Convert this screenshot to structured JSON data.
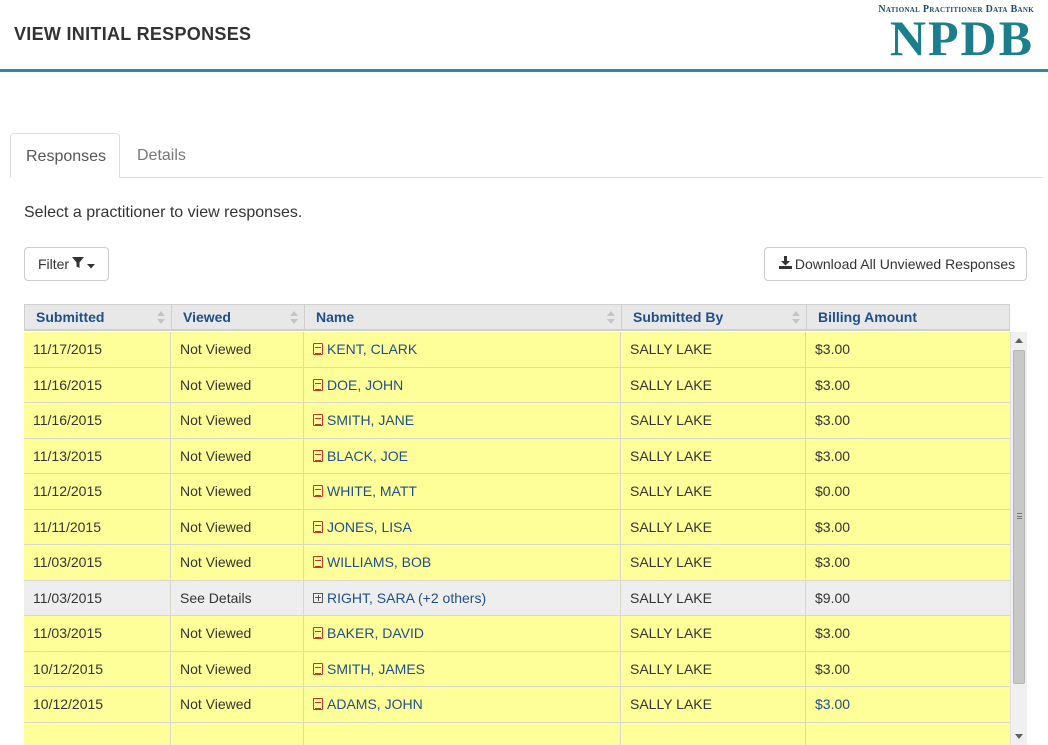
{
  "header": {
    "title": "VIEW INITIAL RESPONSES",
    "logo_sub": "National Practitioner Data Bank",
    "logo_main": "NPDB"
  },
  "tabs": [
    {
      "label": "Responses",
      "active": true
    },
    {
      "label": "Details",
      "active": false
    }
  ],
  "instructions": "Select a practitioner to view responses.",
  "toolbar": {
    "filter_label": "Filter",
    "download_label": "Download All Unviewed Responses"
  },
  "table": {
    "columns": [
      "Submitted",
      "Viewed",
      "Name",
      "Submitted By",
      "Billing Amount"
    ],
    "rows": [
      {
        "submitted": "11/17/2015",
        "viewed": "Not Viewed",
        "name": "KENT, CLARK",
        "submitted_by": "SALLY LAKE",
        "billing": "$3.00",
        "icon": "pdf-icon",
        "highlight": "yellow"
      },
      {
        "submitted": "11/16/2015",
        "viewed": "Not Viewed",
        "name": "DOE, JOHN",
        "submitted_by": "SALLY LAKE",
        "billing": "$3.00",
        "icon": "pdf-icon",
        "highlight": "yellow"
      },
      {
        "submitted": "11/16/2015",
        "viewed": "Not Viewed",
        "name": "SMITH, JANE",
        "submitted_by": "SALLY LAKE",
        "billing": "$3.00",
        "icon": "pdf-icon",
        "highlight": "yellow"
      },
      {
        "submitted": "11/13/2015",
        "viewed": "Not Viewed",
        "name": "BLACK, JOE",
        "submitted_by": "SALLY LAKE",
        "billing": "$3.00",
        "icon": "pdf-icon",
        "highlight": "yellow"
      },
      {
        "submitted": "11/12/2015",
        "viewed": "Not Viewed",
        "name": "WHITE, MATT",
        "submitted_by": "SALLY LAKE",
        "billing": "$0.00",
        "icon": "pdf-icon",
        "highlight": "yellow"
      },
      {
        "submitted": "11/11/2015",
        "viewed": "Not Viewed",
        "name": "JONES, LISA",
        "submitted_by": "SALLY LAKE",
        "billing": "$3.00",
        "icon": "pdf-icon",
        "highlight": "yellow"
      },
      {
        "submitted": "11/03/2015",
        "viewed": "Not Viewed",
        "name": "WILLIAMS, BOB",
        "submitted_by": "SALLY LAKE",
        "billing": "$3.00",
        "icon": "pdf-icon",
        "highlight": "yellow"
      },
      {
        "submitted": "11/03/2015",
        "viewed": "See Details",
        "name": "RIGHT, SARA (+2 others)",
        "submitted_by": "SALLY LAKE",
        "billing": "$9.00",
        "icon": "plus-square-icon",
        "highlight": "grey"
      },
      {
        "submitted": "11/03/2015",
        "viewed": "Not Viewed",
        "name": "BAKER, DAVID",
        "submitted_by": "SALLY LAKE",
        "billing": "$3.00",
        "icon": "pdf-icon",
        "highlight": "yellow"
      },
      {
        "submitted": "10/12/2015",
        "viewed": "Not Viewed",
        "name": "SMITH, JAMES",
        "submitted_by": "SALLY LAKE",
        "billing": "$3.00",
        "icon": "pdf-icon",
        "highlight": "yellow"
      },
      {
        "submitted": "10/12/2015",
        "viewed": "Not Viewed",
        "name": "ADAMS, JOHN",
        "submitted_by": "SALLY LAKE",
        "billing": "$3.00",
        "icon": "pdf-icon",
        "highlight": "yellow",
        "billing_link": true
      },
      {
        "submitted": "",
        "viewed": "",
        "name": "",
        "submitted_by": "",
        "billing": "",
        "icon": "",
        "highlight": "yellow"
      }
    ]
  },
  "colors": {
    "accent": "#2a8c99",
    "logo": "#1a7e8c",
    "link": "#1f4f8a",
    "row_unviewed": "#ffff99",
    "row_details": "#eeeeee"
  }
}
